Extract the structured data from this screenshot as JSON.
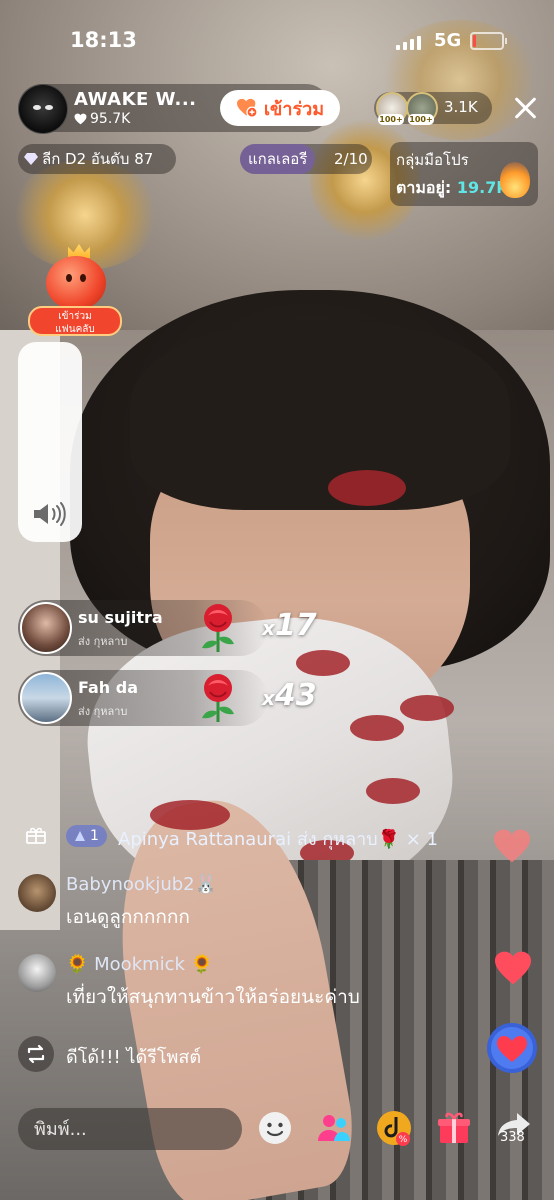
{
  "status_bar": {
    "time": "18:13",
    "network": "5G"
  },
  "host": {
    "name": "AWAKE W...",
    "likes": "95.7K",
    "join_label": "เข้าร่วม"
  },
  "viewers": {
    "count": "3.1K",
    "badge1": "100+",
    "badge2": "100+"
  },
  "league": {
    "label": "ลีก D2 อันดับ 87"
  },
  "gallery": {
    "label": "แกลเลอรี",
    "progress": "2/10"
  },
  "ranking": {
    "title": "กลุ่มมือโปร",
    "label": "ตามอยู่:",
    "value": "19.7k"
  },
  "fan_club": {
    "label_line1": "เข้าร่วม",
    "label_line2": "แฟนคลับ"
  },
  "gifts": [
    {
      "user": "su sujitra",
      "action": "ส่ง กุหลาบ",
      "prefix": "x",
      "count": "17"
    },
    {
      "user": "Fah da",
      "action": "ส่ง กุหลาบ",
      "prefix": "x",
      "count": "43"
    }
  ],
  "system_message": {
    "badge_level": "1",
    "text": "Apinya Rattanaurai ส่ง กุหลาบ🌹 × 1"
  },
  "comments": [
    {
      "user": "Babynookjub2🐰",
      "text": "เอนดูลูกกกกกก"
    },
    {
      "user": "🌻 Mookmick 🌻",
      "text": "เที่ยวให้สนุกทานข้าวให้อร่อยนะค่าบ"
    }
  ],
  "repost": {
    "text": "ดีโด้!!! ได้รีโพสต์"
  },
  "input": {
    "placeholder": "พิมพ์..."
  },
  "share": {
    "count": "338"
  },
  "colors": {
    "join": "#ff5a2b",
    "rank_value": "#5fe6e6",
    "heart": "#ff4d5e",
    "fan_label": "#f2452e"
  },
  "icons": [
    "speaker-icon",
    "gift-icon",
    "repost-icon",
    "emoji-icon",
    "people-icon",
    "coupon-icon",
    "share-icon",
    "close-icon",
    "heart-icon"
  ]
}
